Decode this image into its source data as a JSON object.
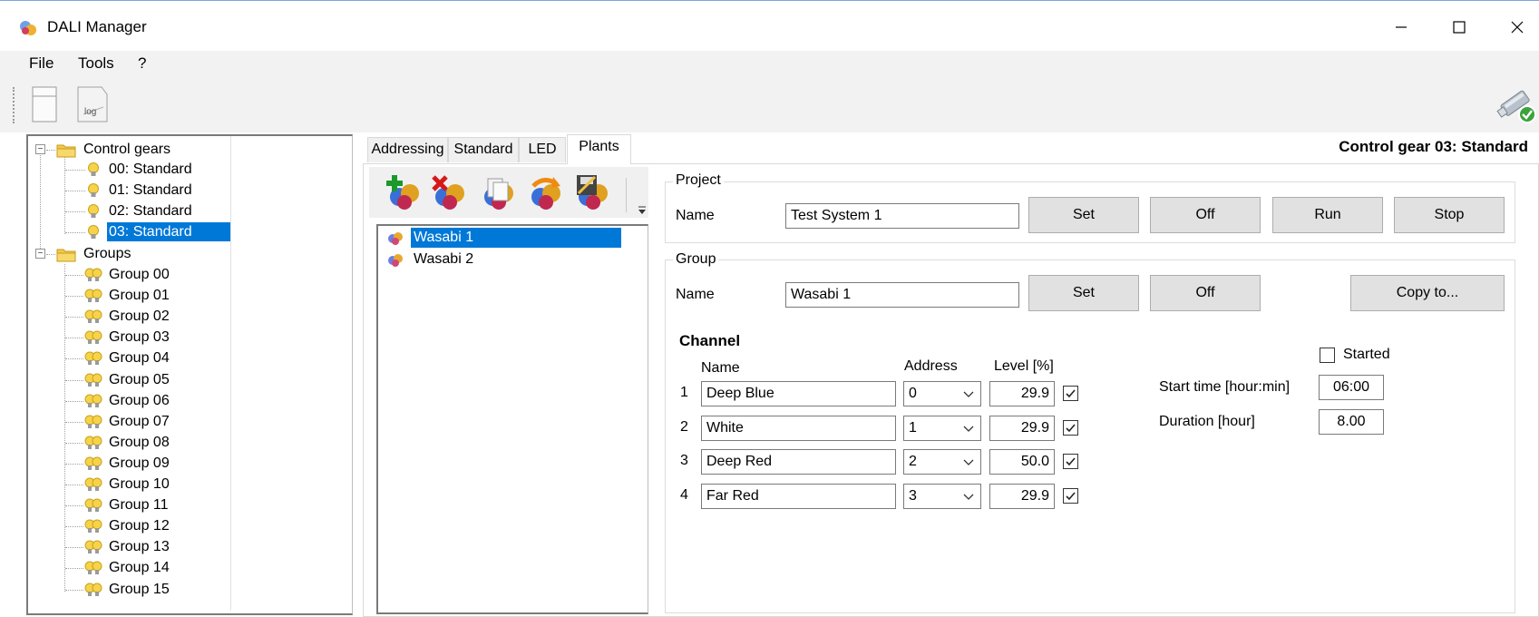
{
  "window": {
    "title": "DALI Manager",
    "minimize_icon": "minimize-icon",
    "maximize_icon": "maximize-icon",
    "close_icon": "close-icon"
  },
  "menu": [
    "File",
    "Tools",
    "?"
  ],
  "toolbar": {
    "buttons": [
      "blank-document-icon",
      "log-icon"
    ],
    "log_label": "log",
    "status_icon": "usb-connected-icon"
  },
  "tree": {
    "control_gears": {
      "label": "Control gears",
      "items": [
        "00: Standard",
        "01: Standard",
        "02: Standard",
        "03: Standard"
      ],
      "selected": "03: Standard"
    },
    "groups": {
      "label": "Groups",
      "items": [
        "Group 00",
        "Group 01",
        "Group 02",
        "Group 03",
        "Group 04",
        "Group 05",
        "Group 06",
        "Group 07",
        "Group 08",
        "Group 09",
        "Group 10",
        "Group 11",
        "Group 12",
        "Group 13",
        "Group 14",
        "Group 15"
      ]
    }
  },
  "tabs": [
    "Addressing",
    "Standard",
    "LED",
    "Plants"
  ],
  "active_tab": "Plants",
  "gear_title": "Control gear 03: Standard",
  "plant_toolbar": [
    "add-plant-icon",
    "delete-plant-icon",
    "copy-plant-icon",
    "refresh-plant-icon",
    "save-plant-icon"
  ],
  "plants": {
    "items": [
      "Wasabi 1",
      "Wasabi 2"
    ],
    "selected": "Wasabi 1"
  },
  "project": {
    "title": "Project",
    "name_label": "Name",
    "name_value": "Test System 1",
    "buttons": [
      "Set",
      "Off",
      "Run",
      "Stop"
    ]
  },
  "group": {
    "title": "Group",
    "name_label": "Name",
    "name_value": "Wasabi 1",
    "set": "Set",
    "off": "Off",
    "copy_to": "Copy to..."
  },
  "channel": {
    "title": "Channel",
    "col_name": "Name",
    "col_address": "Address",
    "col_level": "Level [%]",
    "rows": [
      {
        "index": "1",
        "name": "Deep Blue",
        "address": "0",
        "level": "29.9",
        "checked": true
      },
      {
        "index": "2",
        "name": "White",
        "address": "1",
        "level": "29.9",
        "checked": true
      },
      {
        "index": "3",
        "name": "Deep Red",
        "address": "2",
        "level": "50.0",
        "checked": true
      },
      {
        "index": "4",
        "name": "Far Red",
        "address": "3",
        "level": "29.9",
        "checked": true
      }
    ]
  },
  "schedule": {
    "started_label": "Started",
    "started": false,
    "start_time_label": "Start time [hour:min]",
    "start_time_value": "06:00",
    "duration_label": "Duration [hour]",
    "duration_value": "8.00"
  },
  "colors": {
    "selection": "#0078d7",
    "button_bg": "#e1e1e1"
  }
}
